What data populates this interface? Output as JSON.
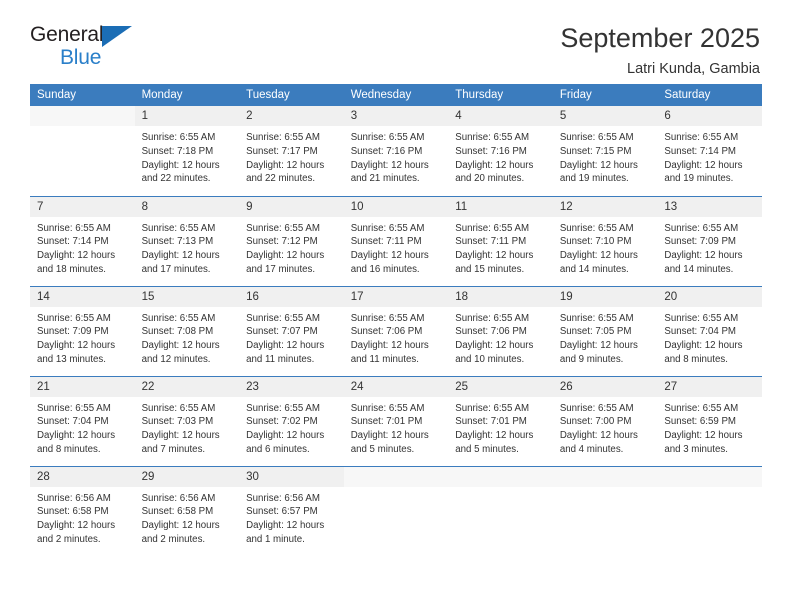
{
  "brand": {
    "name_part1": "General",
    "name_part2": "Blue",
    "triangle_color": "#1b6db5",
    "text_color": "#231f20",
    "accent_color": "#2a7fc9"
  },
  "header": {
    "title": "September 2025",
    "subtitle": "Latri Kunda, Gambia",
    "header_bg": "#3b7cbe",
    "daynum_bg": "#f0f0f0"
  },
  "weekdays": [
    "Sunday",
    "Monday",
    "Tuesday",
    "Wednesday",
    "Thursday",
    "Friday",
    "Saturday"
  ],
  "weeks": [
    [
      {
        "day": "",
        "sunrise": "",
        "sunset": "",
        "daylight1": "",
        "daylight2": ""
      },
      {
        "day": "1",
        "sunrise": "Sunrise: 6:55 AM",
        "sunset": "Sunset: 7:18 PM",
        "daylight1": "Daylight: 12 hours",
        "daylight2": "and 22 minutes."
      },
      {
        "day": "2",
        "sunrise": "Sunrise: 6:55 AM",
        "sunset": "Sunset: 7:17 PM",
        "daylight1": "Daylight: 12 hours",
        "daylight2": "and 22 minutes."
      },
      {
        "day": "3",
        "sunrise": "Sunrise: 6:55 AM",
        "sunset": "Sunset: 7:16 PM",
        "daylight1": "Daylight: 12 hours",
        "daylight2": "and 21 minutes."
      },
      {
        "day": "4",
        "sunrise": "Sunrise: 6:55 AM",
        "sunset": "Sunset: 7:16 PM",
        "daylight1": "Daylight: 12 hours",
        "daylight2": "and 20 minutes."
      },
      {
        "day": "5",
        "sunrise": "Sunrise: 6:55 AM",
        "sunset": "Sunset: 7:15 PM",
        "daylight1": "Daylight: 12 hours",
        "daylight2": "and 19 minutes."
      },
      {
        "day": "6",
        "sunrise": "Sunrise: 6:55 AM",
        "sunset": "Sunset: 7:14 PM",
        "daylight1": "Daylight: 12 hours",
        "daylight2": "and 19 minutes."
      }
    ],
    [
      {
        "day": "7",
        "sunrise": "Sunrise: 6:55 AM",
        "sunset": "Sunset: 7:14 PM",
        "daylight1": "Daylight: 12 hours",
        "daylight2": "and 18 minutes."
      },
      {
        "day": "8",
        "sunrise": "Sunrise: 6:55 AM",
        "sunset": "Sunset: 7:13 PM",
        "daylight1": "Daylight: 12 hours",
        "daylight2": "and 17 minutes."
      },
      {
        "day": "9",
        "sunrise": "Sunrise: 6:55 AM",
        "sunset": "Sunset: 7:12 PM",
        "daylight1": "Daylight: 12 hours",
        "daylight2": "and 17 minutes."
      },
      {
        "day": "10",
        "sunrise": "Sunrise: 6:55 AM",
        "sunset": "Sunset: 7:11 PM",
        "daylight1": "Daylight: 12 hours",
        "daylight2": "and 16 minutes."
      },
      {
        "day": "11",
        "sunrise": "Sunrise: 6:55 AM",
        "sunset": "Sunset: 7:11 PM",
        "daylight1": "Daylight: 12 hours",
        "daylight2": "and 15 minutes."
      },
      {
        "day": "12",
        "sunrise": "Sunrise: 6:55 AM",
        "sunset": "Sunset: 7:10 PM",
        "daylight1": "Daylight: 12 hours",
        "daylight2": "and 14 minutes."
      },
      {
        "day": "13",
        "sunrise": "Sunrise: 6:55 AM",
        "sunset": "Sunset: 7:09 PM",
        "daylight1": "Daylight: 12 hours",
        "daylight2": "and 14 minutes."
      }
    ],
    [
      {
        "day": "14",
        "sunrise": "Sunrise: 6:55 AM",
        "sunset": "Sunset: 7:09 PM",
        "daylight1": "Daylight: 12 hours",
        "daylight2": "and 13 minutes."
      },
      {
        "day": "15",
        "sunrise": "Sunrise: 6:55 AM",
        "sunset": "Sunset: 7:08 PM",
        "daylight1": "Daylight: 12 hours",
        "daylight2": "and 12 minutes."
      },
      {
        "day": "16",
        "sunrise": "Sunrise: 6:55 AM",
        "sunset": "Sunset: 7:07 PM",
        "daylight1": "Daylight: 12 hours",
        "daylight2": "and 11 minutes."
      },
      {
        "day": "17",
        "sunrise": "Sunrise: 6:55 AM",
        "sunset": "Sunset: 7:06 PM",
        "daylight1": "Daylight: 12 hours",
        "daylight2": "and 11 minutes."
      },
      {
        "day": "18",
        "sunrise": "Sunrise: 6:55 AM",
        "sunset": "Sunset: 7:06 PM",
        "daylight1": "Daylight: 12 hours",
        "daylight2": "and 10 minutes."
      },
      {
        "day": "19",
        "sunrise": "Sunrise: 6:55 AM",
        "sunset": "Sunset: 7:05 PM",
        "daylight1": "Daylight: 12 hours",
        "daylight2": "and 9 minutes."
      },
      {
        "day": "20",
        "sunrise": "Sunrise: 6:55 AM",
        "sunset": "Sunset: 7:04 PM",
        "daylight1": "Daylight: 12 hours",
        "daylight2": "and 8 minutes."
      }
    ],
    [
      {
        "day": "21",
        "sunrise": "Sunrise: 6:55 AM",
        "sunset": "Sunset: 7:04 PM",
        "daylight1": "Daylight: 12 hours",
        "daylight2": "and 8 minutes."
      },
      {
        "day": "22",
        "sunrise": "Sunrise: 6:55 AM",
        "sunset": "Sunset: 7:03 PM",
        "daylight1": "Daylight: 12 hours",
        "daylight2": "and 7 minutes."
      },
      {
        "day": "23",
        "sunrise": "Sunrise: 6:55 AM",
        "sunset": "Sunset: 7:02 PM",
        "daylight1": "Daylight: 12 hours",
        "daylight2": "and 6 minutes."
      },
      {
        "day": "24",
        "sunrise": "Sunrise: 6:55 AM",
        "sunset": "Sunset: 7:01 PM",
        "daylight1": "Daylight: 12 hours",
        "daylight2": "and 5 minutes."
      },
      {
        "day": "25",
        "sunrise": "Sunrise: 6:55 AM",
        "sunset": "Sunset: 7:01 PM",
        "daylight1": "Daylight: 12 hours",
        "daylight2": "and 5 minutes."
      },
      {
        "day": "26",
        "sunrise": "Sunrise: 6:55 AM",
        "sunset": "Sunset: 7:00 PM",
        "daylight1": "Daylight: 12 hours",
        "daylight2": "and 4 minutes."
      },
      {
        "day": "27",
        "sunrise": "Sunrise: 6:55 AM",
        "sunset": "Sunset: 6:59 PM",
        "daylight1": "Daylight: 12 hours",
        "daylight2": "and 3 minutes."
      }
    ],
    [
      {
        "day": "28",
        "sunrise": "Sunrise: 6:56 AM",
        "sunset": "Sunset: 6:58 PM",
        "daylight1": "Daylight: 12 hours",
        "daylight2": "and 2 minutes."
      },
      {
        "day": "29",
        "sunrise": "Sunrise: 6:56 AM",
        "sunset": "Sunset: 6:58 PM",
        "daylight1": "Daylight: 12 hours",
        "daylight2": "and 2 minutes."
      },
      {
        "day": "30",
        "sunrise": "Sunrise: 6:56 AM",
        "sunset": "Sunset: 6:57 PM",
        "daylight1": "Daylight: 12 hours",
        "daylight2": "and 1 minute."
      },
      {
        "day": "",
        "sunrise": "",
        "sunset": "",
        "daylight1": "",
        "daylight2": ""
      },
      {
        "day": "",
        "sunrise": "",
        "sunset": "",
        "daylight1": "",
        "daylight2": ""
      },
      {
        "day": "",
        "sunrise": "",
        "sunset": "",
        "daylight1": "",
        "daylight2": ""
      },
      {
        "day": "",
        "sunrise": "",
        "sunset": "",
        "daylight1": "",
        "daylight2": ""
      }
    ]
  ]
}
